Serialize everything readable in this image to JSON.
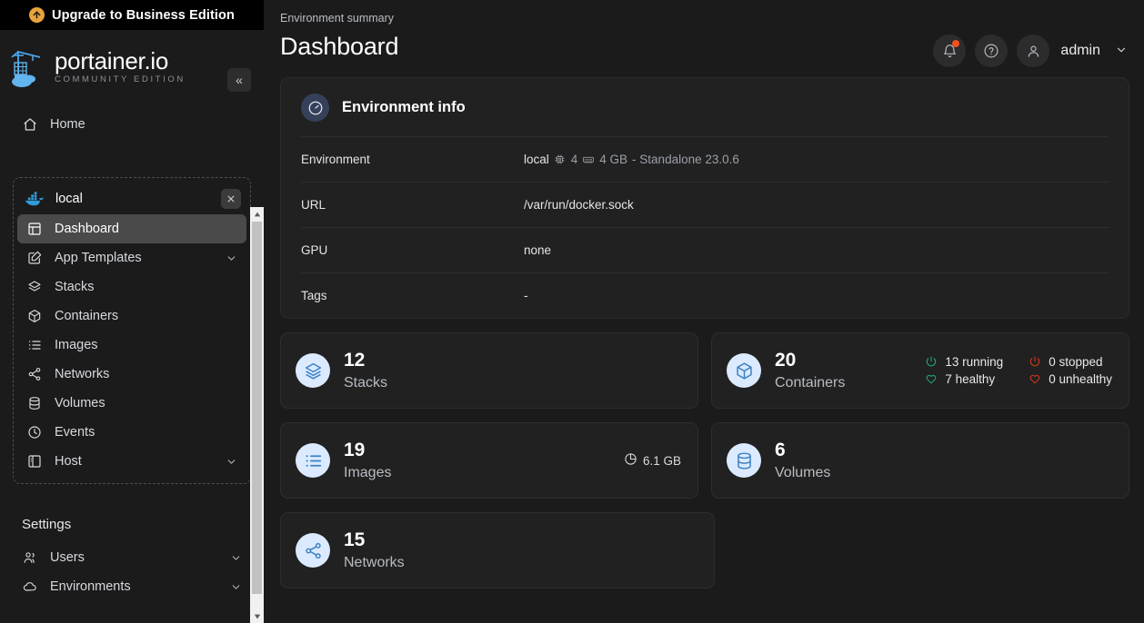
{
  "banner": {
    "label": "Upgrade to Business Edition",
    "icon": "arrow-up-circle-icon",
    "accent": "#e8a33d"
  },
  "brand": {
    "name": "portainer.io",
    "subtitle": "COMMUNITY EDITION",
    "logo_icon": "portainer-crane-logo"
  },
  "sidebar": {
    "collapse_label": "«",
    "home": {
      "label": "Home",
      "icon": "home-icon"
    },
    "environment": {
      "name": "local",
      "icon": "docker-whale-icon",
      "close_label": "✕"
    },
    "env_items": [
      {
        "label": "Dashboard",
        "icon": "dashboard-icon",
        "active": true,
        "chevron": false
      },
      {
        "label": "App Templates",
        "icon": "edit-square-icon",
        "active": false,
        "chevron": true
      },
      {
        "label": "Stacks",
        "icon": "layers-icon",
        "active": false,
        "chevron": false
      },
      {
        "label": "Containers",
        "icon": "cube-icon",
        "active": false,
        "chevron": false
      },
      {
        "label": "Images",
        "icon": "list-icon",
        "active": false,
        "chevron": false
      },
      {
        "label": "Networks",
        "icon": "share-nodes-icon",
        "active": false,
        "chevron": false
      },
      {
        "label": "Volumes",
        "icon": "database-icon",
        "active": false,
        "chevron": false
      },
      {
        "label": "Events",
        "icon": "clock-icon",
        "active": false,
        "chevron": false
      },
      {
        "label": "Host",
        "icon": "server-panel-icon",
        "active": false,
        "chevron": true
      }
    ],
    "settings_label": "Settings",
    "settings_items": [
      {
        "label": "Users",
        "icon": "users-icon",
        "chevron": true
      },
      {
        "label": "Environments",
        "icon": "cloud-icon",
        "chevron": true
      }
    ]
  },
  "header": {
    "breadcrumb": "Environment summary",
    "title": "Dashboard",
    "notifications_icon": "bell-icon",
    "notifications_badge": true,
    "help_icon": "question-circle-icon",
    "avatar_icon": "user-icon",
    "user": "admin",
    "user_chevron": "˅"
  },
  "environment_info": {
    "title": "Environment info",
    "icon": "gauge-icon",
    "rows": [
      {
        "key": "Environment",
        "value": "local",
        "cpu": "4",
        "memory": "4 GB",
        "detail": "- Standalone 23.0.6",
        "cpu_icon": "cpu-icon",
        "memory_icon": "memory-icon"
      },
      {
        "key": "URL",
        "value": "/var/run/docker.sock"
      },
      {
        "key": "GPU",
        "value": "none"
      },
      {
        "key": "Tags",
        "value": "-"
      }
    ]
  },
  "stats": {
    "stacks": {
      "count": "12",
      "label": "Stacks",
      "icon": "layers-icon"
    },
    "containers": {
      "count": "20",
      "label": "Containers",
      "icon": "cube-icon",
      "statuses": [
        {
          "text": "13 running",
          "icon": "power-icon",
          "color": "green"
        },
        {
          "text": "0 stopped",
          "icon": "power-icon",
          "color": "red"
        },
        {
          "text": "7 healthy",
          "icon": "heart-icon",
          "color": "green"
        },
        {
          "text": "0 unhealthy",
          "icon": "heart-icon",
          "color": "red"
        }
      ]
    },
    "images": {
      "count": "19",
      "label": "Images",
      "icon": "list-icon",
      "size": "6.1 GB",
      "size_icon": "pie-chart-icon"
    },
    "volumes": {
      "count": "6",
      "label": "Volumes",
      "icon": "database-icon"
    },
    "networks": {
      "count": "15",
      "label": "Networks",
      "icon": "share-nodes-icon"
    }
  },
  "scrollbar": {
    "up_arrow": "▲",
    "down_arrow": "▼"
  }
}
